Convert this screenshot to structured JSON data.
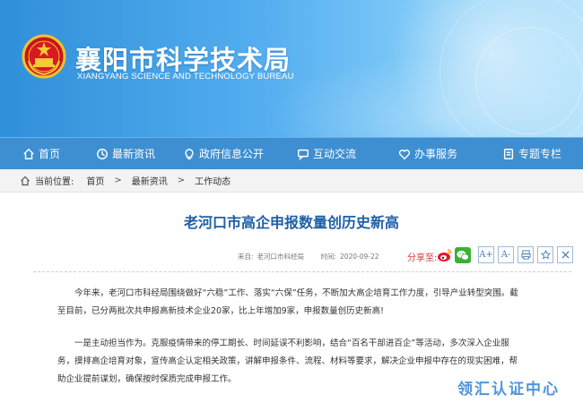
{
  "header": {
    "site_title": "襄阳市科学技术局",
    "site_subtitle": "XIANGYANG SCIENCE AND TECHNOLOGY BUREAU",
    "emblem_icon": "national-emblem-icon"
  },
  "nav": {
    "items": [
      {
        "label": "首页",
        "icon": "home-icon"
      },
      {
        "label": "最新资讯",
        "icon": "clock-icon"
      },
      {
        "label": "政府信息公开",
        "icon": "lightbulb-icon"
      },
      {
        "label": "互动交流",
        "icon": "chat-icon"
      },
      {
        "label": "办事服务",
        "icon": "heart-icon"
      },
      {
        "label": "专题专栏",
        "icon": "document-icon"
      }
    ]
  },
  "breadcrumb": {
    "prefix": "当前位置:",
    "items": [
      "首页",
      "最新资讯",
      "工作动态"
    ],
    "separator": ">"
  },
  "article": {
    "title": "老河口市高企申报数量创历史新高",
    "source_label": "来自:",
    "source": "老河口市科经局",
    "time_label": "时间:",
    "time": "2020-09-22",
    "share_label": "分享至:",
    "paragraphs": [
      "今年来，老河口市科经局围绕做好“六稳”工作、落实“六保”任务，不断加大高企培育工作力度，引导产业转型突围。截至目前，已分两批次共申报高新技术企业20家，比上年增加9家，申报数量创历史新高!",
      "一是主动担当作为。克服疫情带来的停工期长、时间延误不利影响，结合“百名干部进百企”等活动，多次深入企业服务，摸排高企培育对象，宣传高企认定相关政策，讲解申报条件、流程、材料等要求，解决企业申报中存在的现实困难，帮助企业提前谋划，确保按时保质完成申报工作。"
    ]
  },
  "toolbar": {
    "font_increase": "A+",
    "font_decrease": "A-"
  },
  "watermark": "领汇认证中心",
  "colors": {
    "nav_bg": "#3d8fd1",
    "title_blue": "#1f5fa8",
    "share_red": "#d3373a"
  }
}
